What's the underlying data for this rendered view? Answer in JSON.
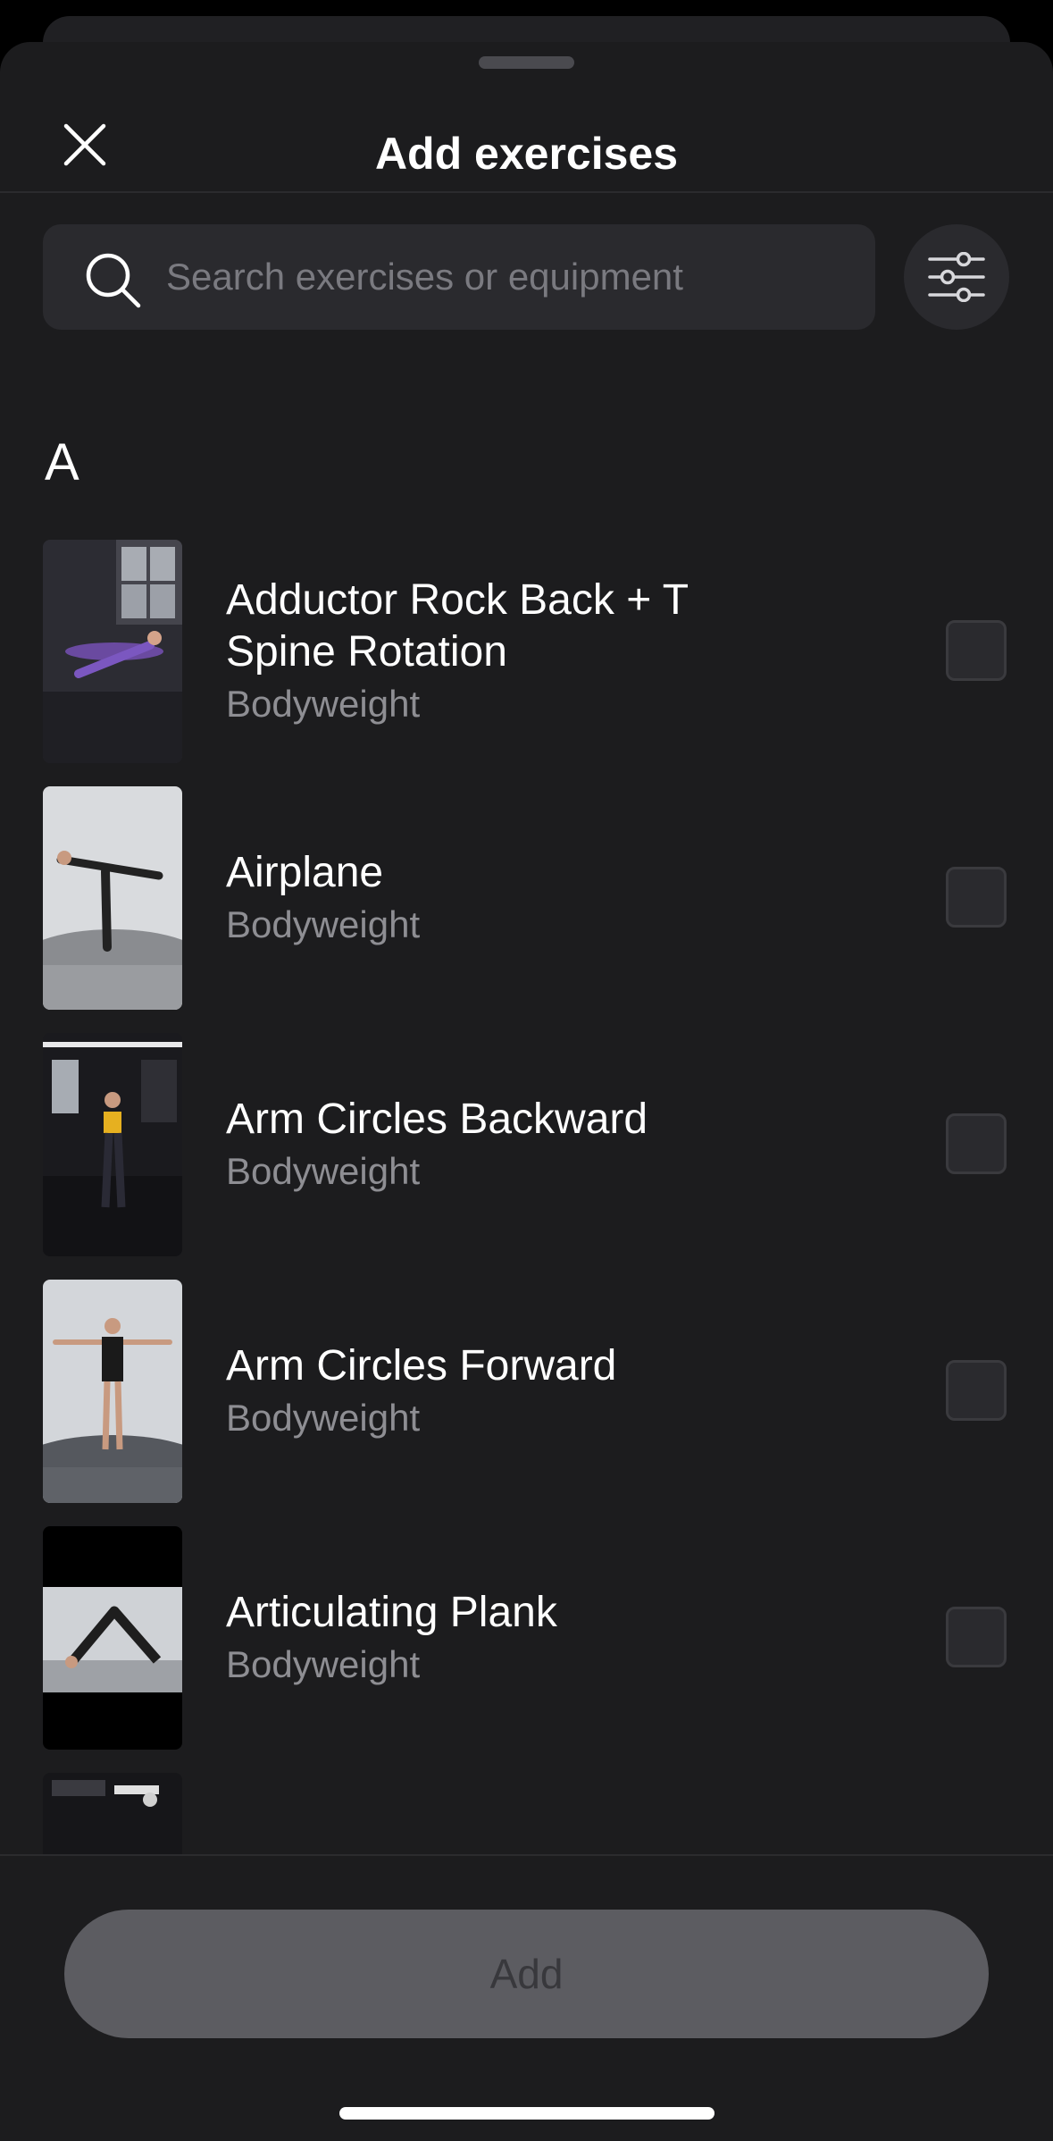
{
  "header": {
    "title": "Add exercises",
    "close_icon": "close-icon"
  },
  "search": {
    "placeholder": "Search exercises or equipment",
    "value": ""
  },
  "filter": {
    "icon": "sliders-icon"
  },
  "section": {
    "letter": "A"
  },
  "exercises": [
    {
      "name": "Adductor Rock Back + T Spine Rotation",
      "equipment": "Bodyweight",
      "checked": false
    },
    {
      "name": "Airplane",
      "equipment": "Bodyweight",
      "checked": false
    },
    {
      "name": "Arm Circles Backward",
      "equipment": "Bodyweight",
      "checked": false
    },
    {
      "name": "Arm Circles Forward",
      "equipment": "Bodyweight",
      "checked": false
    },
    {
      "name": "Articulating Plank",
      "equipment": "Bodyweight",
      "checked": false
    }
  ],
  "footer": {
    "add_label": "Add"
  },
  "colors": {
    "sheet_bg": "#1c1c1e",
    "field_bg": "#2a2a2e",
    "secondary_text": "#8e8e93",
    "button_disabled": "#5c5c61"
  }
}
